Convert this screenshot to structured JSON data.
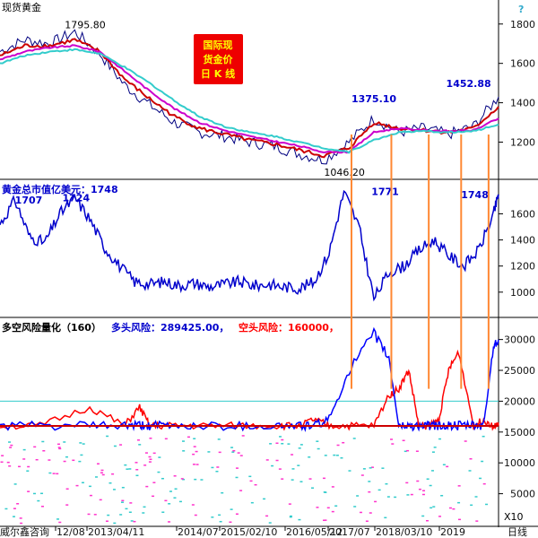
{
  "chart_data": [
    {
      "panel": "price",
      "type": "line",
      "title": "现货黄金",
      "badge": [
        "国际现",
        "货金价",
        "日 K 线"
      ],
      "help_mark": "?",
      "ylim": [
        1020,
        1840
      ],
      "yticks": [
        1200,
        1400,
        1600,
        1800
      ],
      "x": [
        0,
        5,
        10,
        15,
        20,
        25,
        30,
        35,
        40,
        45,
        50,
        55,
        60,
        65,
        70,
        75,
        80,
        85,
        90,
        95,
        100
      ],
      "series": [
        {
          "values": [
            1660,
            1720,
            1700,
            1760,
            1650,
            1490,
            1390,
            1300,
            1250,
            1230,
            1200,
            1180,
            1140,
            1110,
            1200,
            1320,
            1250,
            1270,
            1240,
            1280,
            1430
          ],
          "color": "#000080"
        },
        {
          "values": [
            1640,
            1690,
            1690,
            1720,
            1660,
            1520,
            1420,
            1330,
            1270,
            1240,
            1210,
            1190,
            1160,
            1130,
            1170,
            1300,
            1270,
            1260,
            1250,
            1270,
            1380
          ],
          "color": "#cc0000"
        },
        {
          "values": [
            1620,
            1660,
            1680,
            1690,
            1660,
            1560,
            1460,
            1370,
            1300,
            1260,
            1230,
            1205,
            1180,
            1150,
            1150,
            1250,
            1270,
            1260,
            1255,
            1260,
            1320
          ],
          "color": "#cc00cc"
        },
        {
          "values": [
            1600,
            1640,
            1660,
            1670,
            1650,
            1580,
            1500,
            1410,
            1330,
            1280,
            1250,
            1230,
            1200,
            1170,
            1150,
            1210,
            1250,
            1255,
            1250,
            1255,
            1290
          ],
          "color": "#33cccc"
        }
      ],
      "annotations": [
        {
          "text": "1795.80",
          "x": 13,
          "y": 1795.8,
          "anchor": "start"
        },
        {
          "text": "1375.10",
          "x": 70.5,
          "y": 1375.1,
          "anchor": "start"
        },
        {
          "text": "1046.20",
          "x": 65,
          "y": 1046.2,
          "anchor": "start"
        },
        {
          "text": "1452.88",
          "x": 98.5,
          "y": 1452.88,
          "anchor": "end"
        }
      ]
    },
    {
      "panel": "market_cap",
      "type": "line",
      "title": "黄金总市值亿美元：1748",
      "ylim": [
        820,
        1830
      ],
      "yticks": [
        1000,
        1200,
        1400,
        1600
      ],
      "x": [
        0,
        3,
        6,
        9,
        12,
        15,
        18,
        21,
        24,
        27,
        30,
        33,
        36,
        39,
        42,
        45,
        48,
        51,
        54,
        57,
        60,
        63,
        66,
        69,
        72,
        75,
        78,
        81,
        84,
        87,
        90,
        93,
        96,
        99,
        100
      ],
      "values": [
        1520,
        1707,
        1420,
        1380,
        1600,
        1724,
        1560,
        1340,
        1200,
        1080,
        1060,
        1080,
        1050,
        1070,
        1040,
        1060,
        1080,
        1050,
        1060,
        1040,
        1030,
        1080,
        1300,
        1771,
        1500,
        950,
        1150,
        1200,
        1320,
        1400,
        1280,
        1200,
        1320,
        1600,
        1748
      ],
      "color": "#0000cc",
      "annotations": [
        {
          "text": "1707",
          "x": 3,
          "y": 1707,
          "anchor": "start"
        },
        {
          "text": "1724",
          "x": 12.5,
          "y": 1724,
          "anchor": "start"
        },
        {
          "text": "1771",
          "x": 74.5,
          "y": 1771,
          "anchor": "start"
        },
        {
          "text": "1748",
          "x": 98,
          "y": 1748,
          "anchor": "end"
        }
      ]
    },
    {
      "panel": "risk",
      "type": "line",
      "title_main": "多空风险量化（160）",
      "title_long": "多头风险：289425.00，",
      "title_short": "空头风险：160000，",
      "ylim": [
        0,
        33000
      ],
      "yticks": [
        5000,
        10000,
        15000,
        20000,
        25000,
        30000
      ],
      "scale_label": "X10",
      "baseline": 16000,
      "ref_line": 20000,
      "x": [
        0,
        8,
        18,
        25,
        28,
        30,
        34,
        40,
        48,
        55,
        60,
        63,
        66,
        70,
        75,
        78,
        80,
        82,
        84,
        86,
        88,
        90,
        92,
        95,
        97,
        99,
        100
      ],
      "long_values": [
        16000,
        16000,
        16000,
        16000,
        16000,
        16000,
        16000,
        16000,
        16000,
        16000,
        16000,
        16000,
        17000,
        25000,
        31000,
        27000,
        16000,
        16000,
        16000,
        16000,
        16000,
        16000,
        16000,
        16000,
        16000,
        29000,
        30000
      ],
      "short_values": [
        16000,
        16000,
        19000,
        16000,
        19000,
        16000,
        16000,
        16000,
        16000,
        16000,
        16000,
        17000,
        16000,
        16000,
        16000,
        21000,
        22000,
        25000,
        16000,
        16000,
        17000,
        25000,
        28000,
        16000,
        17000,
        16000,
        16000
      ],
      "long_color": "#0000ff",
      "short_color": "#ff0000",
      "baseline_color": "#cc0000",
      "ref_color": "#33cccc"
    }
  ],
  "x_axis": {
    "ticks": [
      "12/08",
      "2013/04/11",
      "2014/07",
      "2015/02/10",
      "2016/05/12",
      "2017/07",
      "2018/03/10",
      "2019"
    ],
    "corner_label": "威尔鑫咨询",
    "suffix": "日线"
  },
  "vertical_markers": [
    70.5,
    78.5,
    86,
    92.5,
    98
  ]
}
